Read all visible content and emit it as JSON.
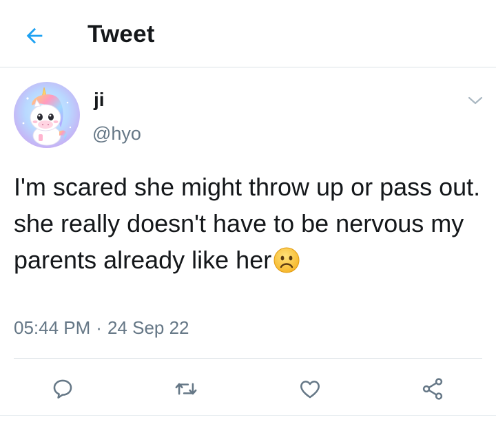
{
  "header": {
    "title": "Tweet",
    "back_icon": "arrow-left-icon",
    "accent_color": "#1da1f2"
  },
  "tweet": {
    "author": {
      "display_name": "ji",
      "handle": "@hyo",
      "avatar": "unicorn-avatar"
    },
    "text": "I'm scared she might throw up or pass out. she really doesn't have to be nervous my parents already like her",
    "trailing_emoji": "frowning-face",
    "time": "05:44 PM",
    "separator": "·",
    "date": "24 Sep 22"
  },
  "actions": {
    "reply": "reply-icon",
    "retweet": "retweet-icon",
    "like": "heart-icon",
    "share": "share-icon",
    "icon_color": "#657786"
  },
  "colors": {
    "text_primary": "#14171a",
    "text_secondary": "#657786",
    "divider": "#dbe1e6"
  }
}
